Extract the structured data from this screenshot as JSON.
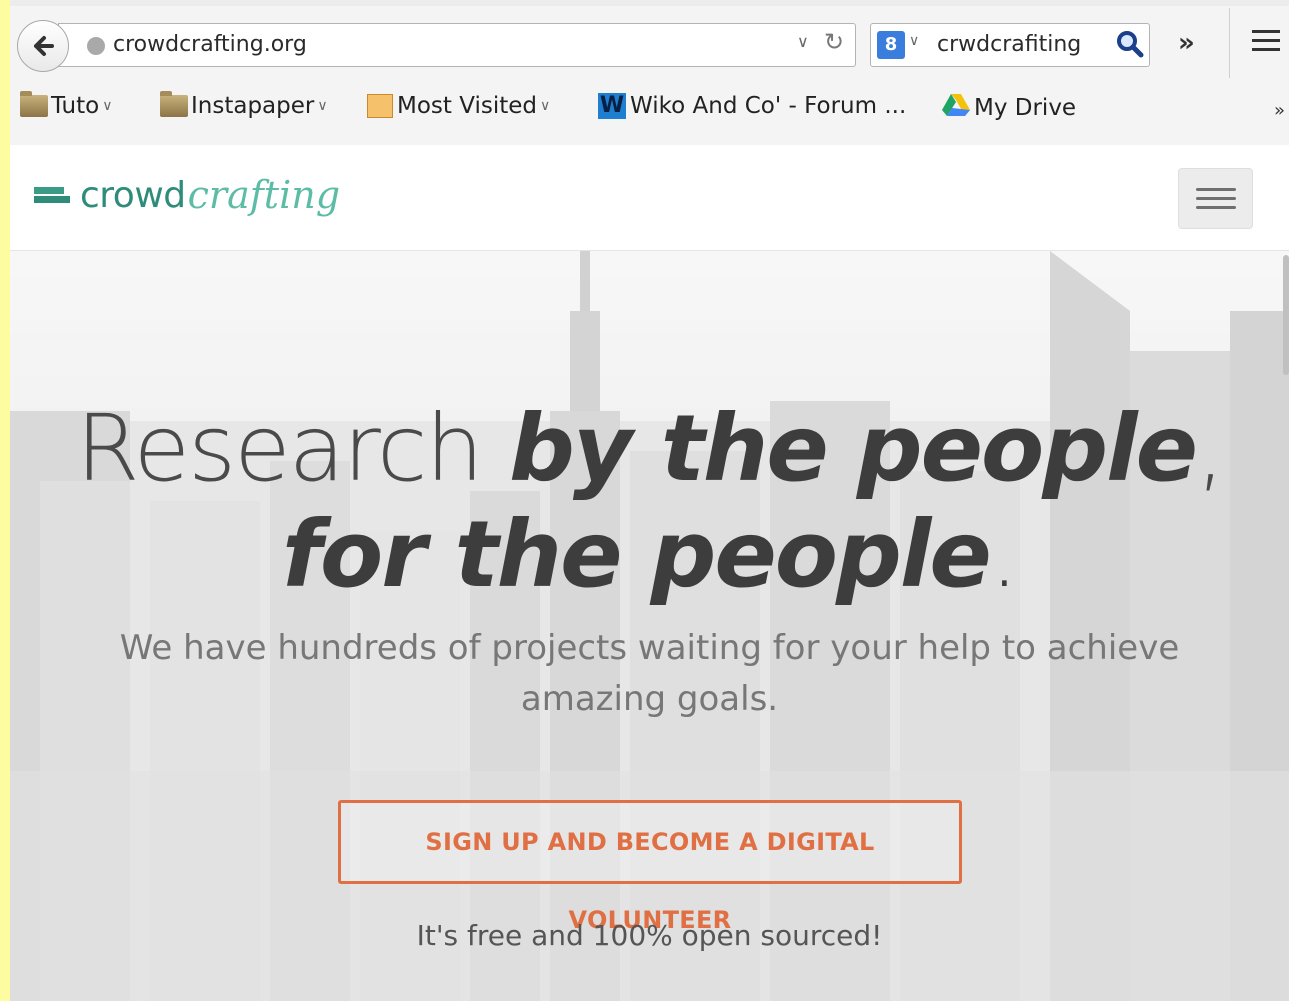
{
  "browser": {
    "url": "crowdcrafting.org",
    "search_query": "crwdcrafiting",
    "search_engine_badge": "8",
    "overflow": "»",
    "bookmarks": [
      {
        "label": "Tuto",
        "icon": "folder-icon"
      },
      {
        "label": "Instapaper",
        "icon": "folder-icon"
      },
      {
        "label": "Most Visited",
        "icon": "most-visited-icon"
      },
      {
        "label": "Wiko And Co' - Forum ...",
        "icon": "wiko-icon"
      },
      {
        "label": "My Drive",
        "icon": "google-drive-icon"
      }
    ],
    "bookmarks_overflow": "»",
    "wiko_letter": "W"
  },
  "site": {
    "brand_plain": "crowd",
    "brand_script": "crafting",
    "hero": {
      "title_light": "Research ",
      "title_bold_1": "by the people",
      "title_punct_1": ",",
      "title_bold_2": "for the people",
      "title_punct_2": ".",
      "subtitle": "We have hundreds of projects waiting for your help to achieve amazing goals.",
      "cta": "SIGN UP AND BECOME A DIGITAL VOLUNTEER",
      "note": "It's free and 100% open sourced!"
    }
  },
  "colors": {
    "desktop_bg": "#fdfca0",
    "brand": "#2f8c7a",
    "accent": "#e07043"
  }
}
